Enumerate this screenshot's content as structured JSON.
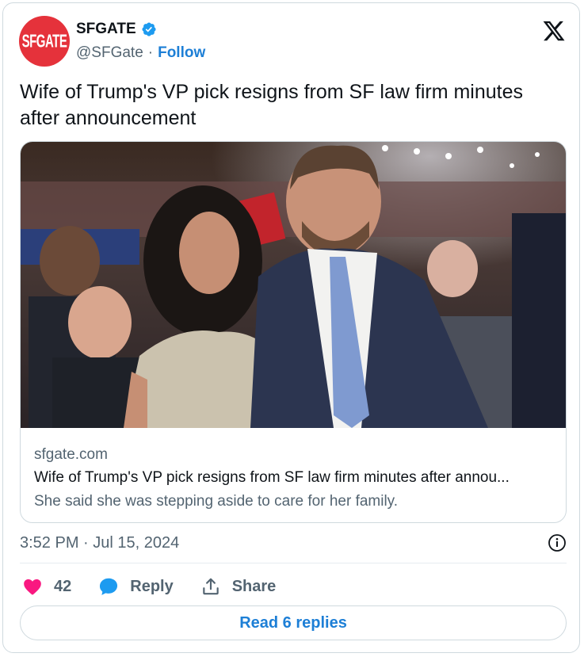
{
  "colors": {
    "brand_red": "#e5323b",
    "link_blue": "#1d7fd6",
    "like_pink": "#f91880",
    "muted_gray": "#536471"
  },
  "account": {
    "avatar_text": "SFGATE",
    "display_name": "SFGATE",
    "handle": "@SFGate",
    "separator": "·",
    "follow_label": "Follow",
    "verified_icon": "verified-badge-icon"
  },
  "platform_icon": "x-logo-icon",
  "tweet": {
    "text": "Wife of Trump's VP pick resigns from SF law firm minutes after announcement"
  },
  "link_card": {
    "domain": "sfgate.com",
    "title": "Wife of Trump's VP pick resigns from SF law firm minutes after annou...",
    "description": "She said she was stepping aside to care for her family."
  },
  "meta": {
    "timestamp": "3:52 PM · Jul 15, 2024",
    "info_icon": "info-icon"
  },
  "actions": {
    "like_count": "42",
    "reply_label": "Reply",
    "share_label": "Share"
  },
  "read_replies_label": "Read 6 replies"
}
